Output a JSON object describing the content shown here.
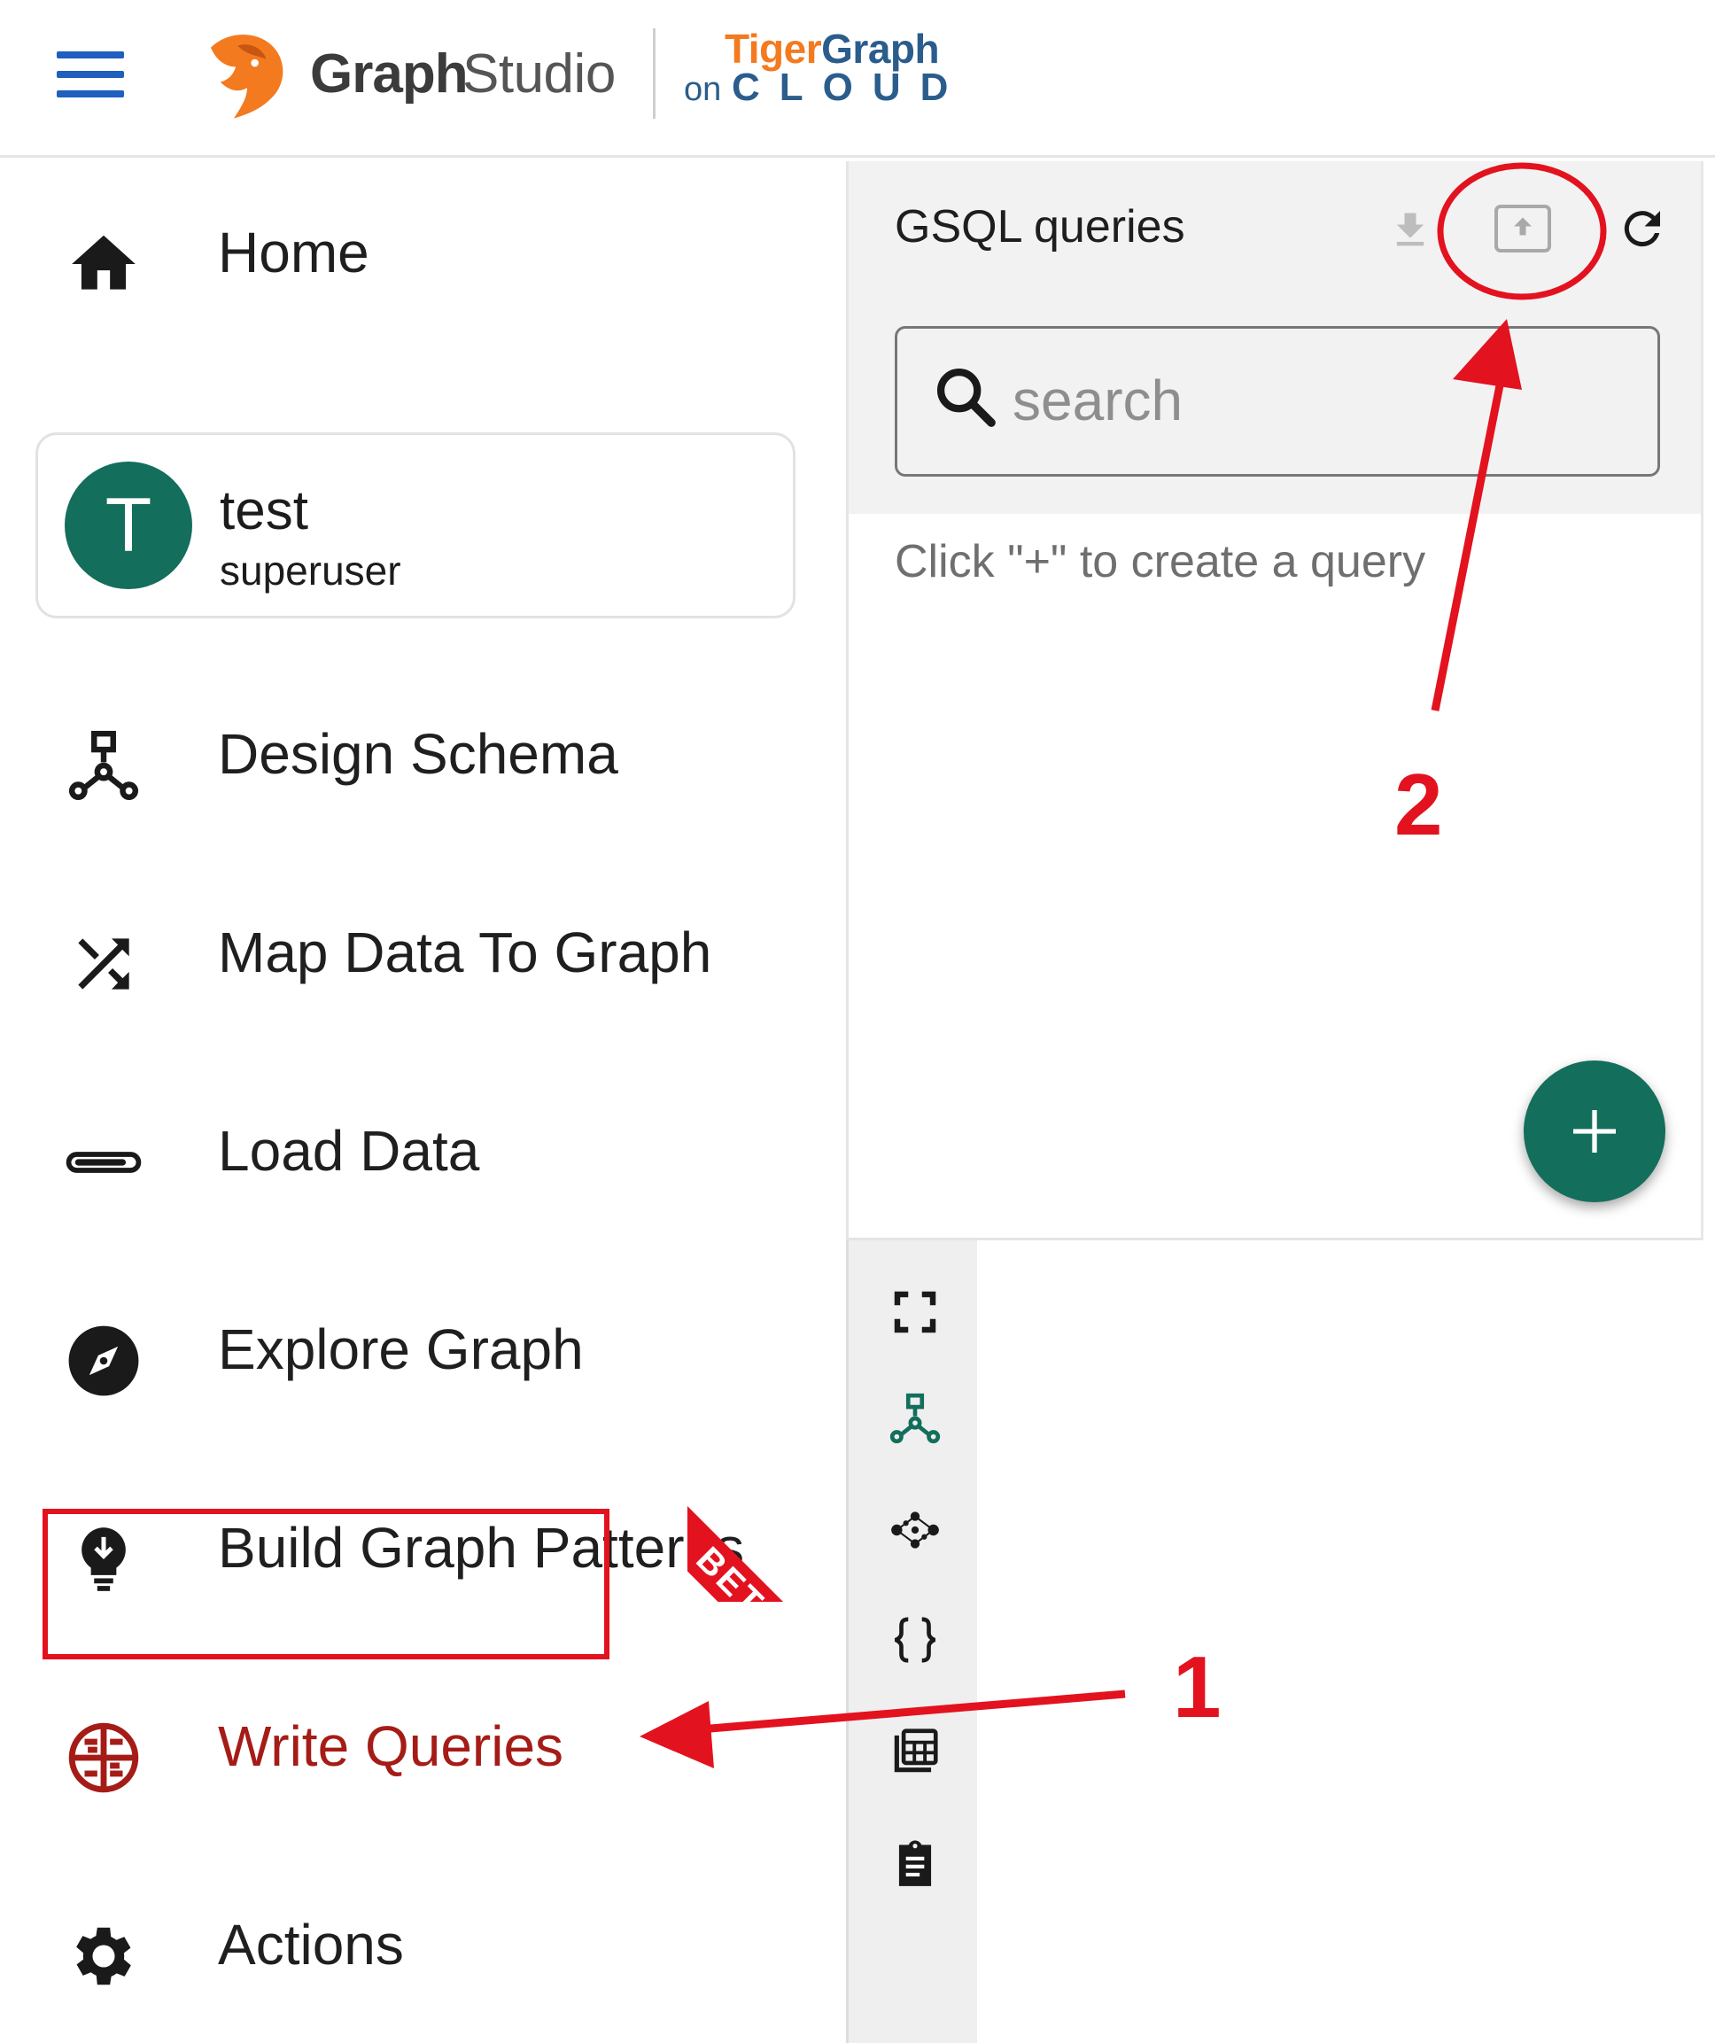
{
  "header": {
    "brand_graph": "Graph",
    "brand_studio": "Studio",
    "partner_tiger": "Tiger",
    "partner_graph": "Graph",
    "partner_on": "on",
    "partner_cloud": "CLOUD",
    "icons": [
      "hamburger-menu-icon",
      "tiger-logo-icon"
    ],
    "colors": {
      "hamburger": "#1e5fbf",
      "logo_orange": "#f47a20",
      "cloud_blue": "#2a5d8c"
    }
  },
  "sidebar": {
    "home": "Home",
    "user": {
      "initial": "T",
      "name": "test",
      "role": "superuser",
      "avatar_color": "#136e5c"
    },
    "items": [
      {
        "label": "Design Schema",
        "icon": "schema-icon"
      },
      {
        "label": "Map Data To Graph",
        "icon": "shuffle-icon"
      },
      {
        "label": "Load Data",
        "icon": "load-bar-icon"
      },
      {
        "label": "Explore Graph",
        "icon": "compass-icon"
      },
      {
        "label": "Build Graph Patterns",
        "icon": "lightbulb-icon",
        "badge": "BETA"
      },
      {
        "label": "Write Queries",
        "icon": "gsql-icon",
        "active": true
      },
      {
        "label": "Actions",
        "icon": "gear-icon"
      }
    ],
    "active_color": "#a51c17"
  },
  "panel": {
    "title": "GSQL queries",
    "search_placeholder": "search",
    "empty_message": "Click \"+\" to create a query",
    "toolbar_icons": [
      "download-icon",
      "upload-icon",
      "refresh-icon"
    ],
    "fab_color": "#136e5c"
  },
  "vertical_toolbar": [
    "fullscreen-icon",
    "schema-icon",
    "graph-nodes-icon",
    "braces-icon",
    "table-icon",
    "clipboard-icon"
  ],
  "annotations": {
    "step1": "1",
    "step2": "2",
    "color": "#e3121f"
  }
}
